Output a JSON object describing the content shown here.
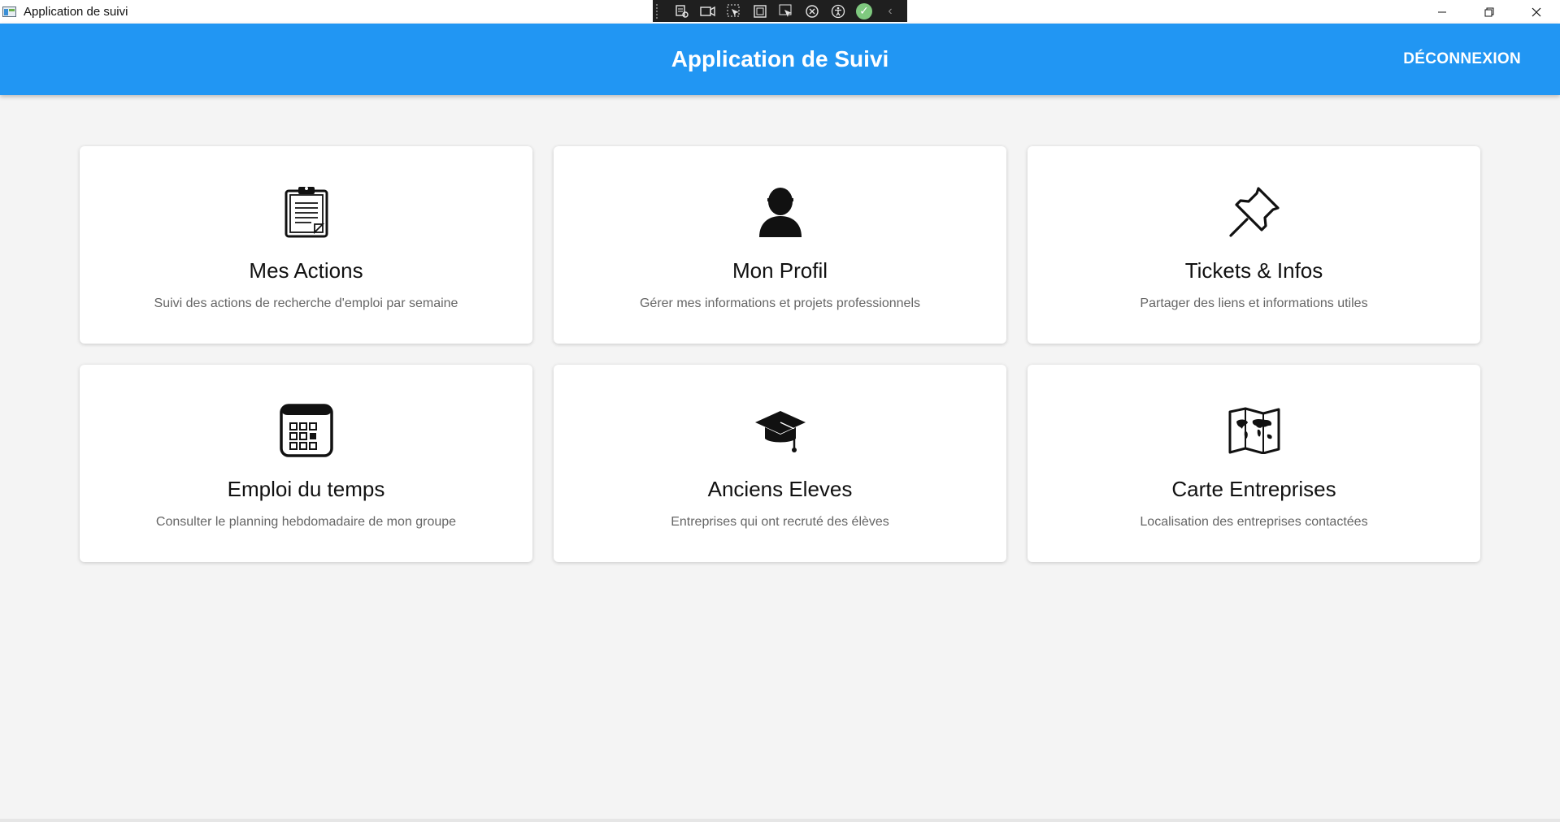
{
  "window": {
    "title": "Application de suivi",
    "controls": {
      "minimize": "—",
      "restore": "❐",
      "close": "✕"
    }
  },
  "debug_toolbar": {
    "buttons": [
      "live-visual-tree-icon",
      "video-icon",
      "select-element-icon",
      "display-layout-adorners-icon",
      "track-focus-icon",
      "hot-reload-icon",
      "accessibility-icon",
      "binding-ok-icon",
      "collapse-icon"
    ]
  },
  "header": {
    "title": "Application de Suivi",
    "logout_label": "DÉCONNEXION",
    "background": "#2196f3"
  },
  "cards": [
    {
      "icon": "clipboard-icon",
      "title": "Mes Actions",
      "description": "Suivi des actions de recherche d'emploi par semaine"
    },
    {
      "icon": "user-icon",
      "title": "Mon Profil",
      "description": "Gérer mes informations et projets professionnels"
    },
    {
      "icon": "pushpin-icon",
      "title": "Tickets & Infos",
      "description": "Partager des liens et informations utiles"
    },
    {
      "icon": "calendar-icon",
      "title": "Emploi du temps",
      "description": "Consulter le planning hebdomadaire de mon groupe"
    },
    {
      "icon": "graduation-cap-icon",
      "title": "Anciens Eleves",
      "description": "Entreprises qui ont recruté des élèves"
    },
    {
      "icon": "world-map-icon",
      "title": "Carte Entreprises",
      "description": "Localisation des entreprises contactées"
    }
  ]
}
